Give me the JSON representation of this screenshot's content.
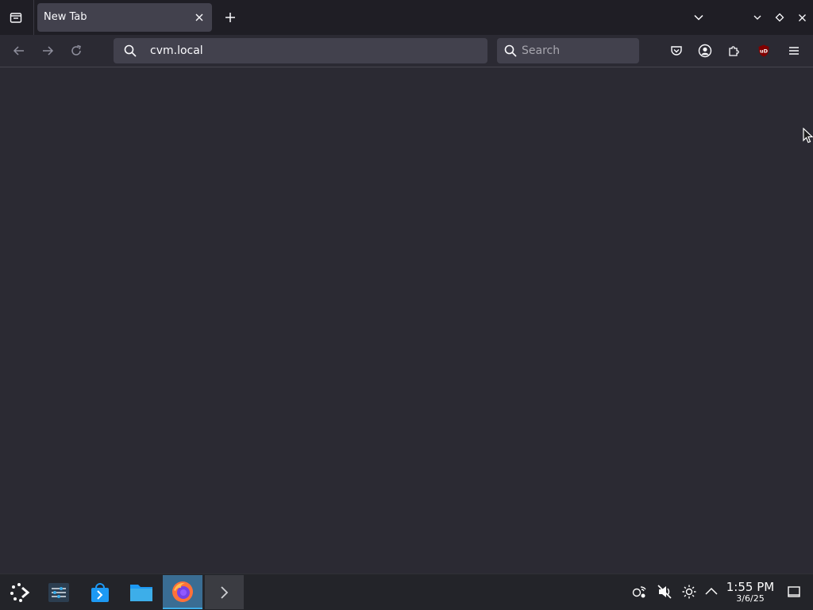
{
  "browser": {
    "tabs": [
      {
        "title": "New Tab",
        "active": true
      }
    ],
    "url": "cvm.local",
    "search_placeholder": "Search",
    "toolbar_icons": [
      "pocket-icon",
      "account-icon",
      "extensions-icon",
      "ublock-icon",
      "menu-icon"
    ],
    "ublock_badge": "uD"
  },
  "taskbar": {
    "launchers": [
      "app-launcher-icon",
      "settings-icon",
      "discover-store-icon",
      "files-icon",
      "firefox-icon",
      "terminal-icon"
    ],
    "tray_icons": [
      "network-icon",
      "volume-muted-icon",
      "brightness-icon",
      "tray-expand-icon",
      "show-desktop-icon"
    ],
    "clock": {
      "time": "1:55 PM",
      "date": "3/6/25"
    }
  },
  "colors": {
    "accent": "#3daee9",
    "content_bg": "#2b2a33",
    "taskbar_bg": "#232429"
  }
}
